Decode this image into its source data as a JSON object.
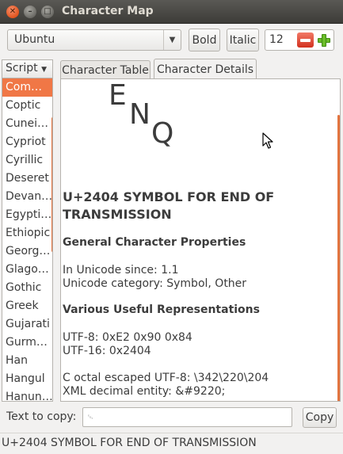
{
  "window": {
    "title": "Character Map",
    "close_glyph": "✕",
    "minimize_glyph": "–",
    "maximize_glyph": "□"
  },
  "toolbar": {
    "font_name": "Ubuntu",
    "bold_label": "Bold",
    "italic_label": "Italic",
    "font_size": "12"
  },
  "sidebar": {
    "header_label": "Script",
    "items": [
      {
        "label": "Com…",
        "selected": true
      },
      {
        "label": "Coptic"
      },
      {
        "label": "Cunei…"
      },
      {
        "label": "Cypriot"
      },
      {
        "label": "Cyrillic"
      },
      {
        "label": "Deseret"
      },
      {
        "label": "Devan…"
      },
      {
        "label": "Egypti…"
      },
      {
        "label": "Ethiopic"
      },
      {
        "label": "Georg…"
      },
      {
        "label": "Glago…"
      },
      {
        "label": "Gothic"
      },
      {
        "label": "Greek"
      },
      {
        "label": "Gujarati"
      },
      {
        "label": "Gurm…"
      },
      {
        "label": "Han"
      },
      {
        "label": "Hangul"
      },
      {
        "label": "Hanun…"
      }
    ]
  },
  "tabs": [
    {
      "label": "Character Table",
      "active": false
    },
    {
      "label": "Character Details",
      "active": true
    }
  ],
  "details": {
    "glyph_letters": [
      "E",
      "N",
      "Q"
    ],
    "heading": "U+2404 SYMBOL FOR END OF TRANSMISSION",
    "general_title": "General Character Properties",
    "unicode_since": "In Unicode since: 1.1",
    "unicode_category": "Unicode category: Symbol, Other",
    "representations_title": "Various Useful Representations",
    "utf8": "UTF-8: 0xE2 0x90 0x84",
    "utf16": "UTF-16: 0x2404",
    "c_octal": "C octal escaped UTF-8: \\342\\220\\204",
    "xml_decimal": "XML decimal entity: &#9220;"
  },
  "copy": {
    "label": "Text to copy:",
    "value": "␄",
    "button_label": "Copy"
  },
  "status": {
    "text": "U+2404 SYMBOL FOR END OF TRANSMISSION"
  },
  "colors": {
    "accent": "#f07746",
    "titlebar": "#3d3c38",
    "close_button": "#e2531d"
  }
}
